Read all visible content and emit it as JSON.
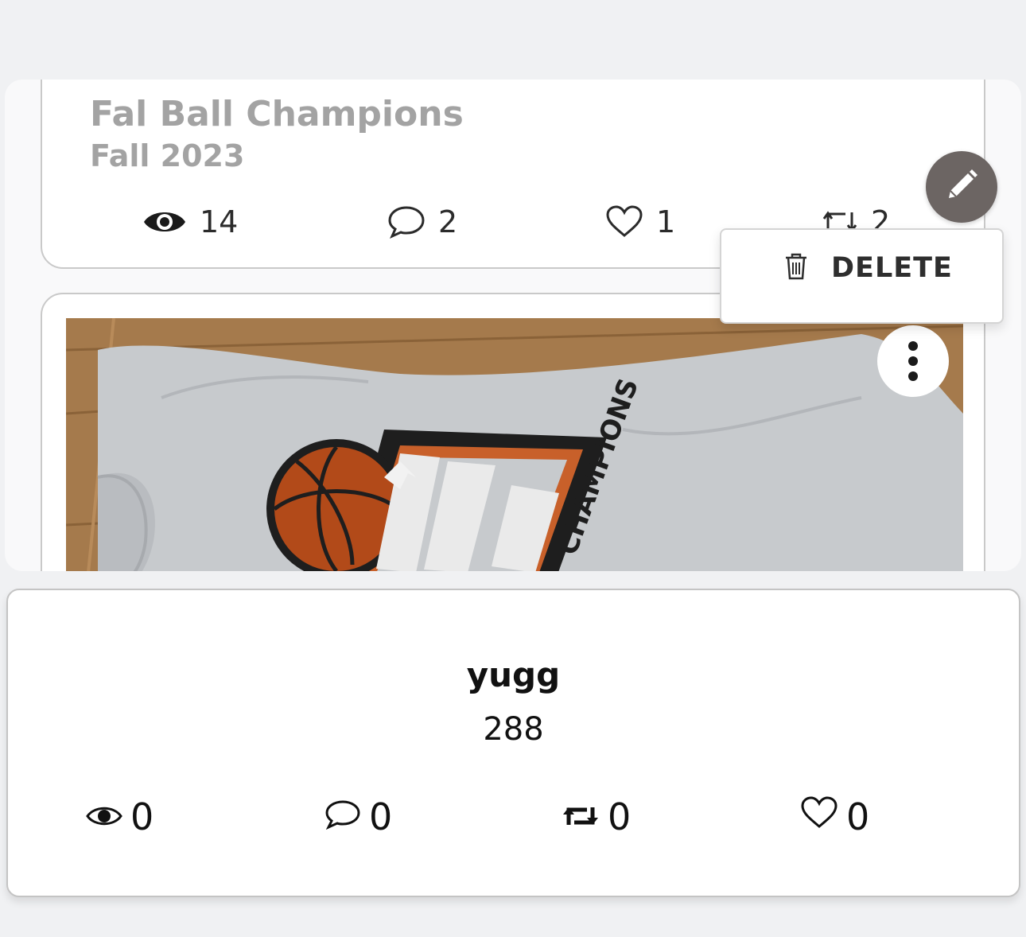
{
  "post": {
    "title": "Fal Ball Champions",
    "subtitle": "Fall 2023",
    "views": "14",
    "comments": "2",
    "likes": "1",
    "reposts": "2"
  },
  "menu": {
    "delete_label": "DELETE"
  },
  "profile": {
    "name": "yugg",
    "number": "288",
    "views": "0",
    "comments": "0",
    "reposts": "0",
    "likes": "0"
  },
  "icons": {
    "views": "eye-icon",
    "comments": "speech-bubble-icon",
    "likes": "heart-icon",
    "reposts": "repost-icon",
    "edit": "pencil-icon",
    "delete": "trash-icon",
    "more": "more-vertical-icon"
  },
  "colors": {
    "edit_fab": "#6c6563",
    "title_text": "#a3a3a3"
  }
}
